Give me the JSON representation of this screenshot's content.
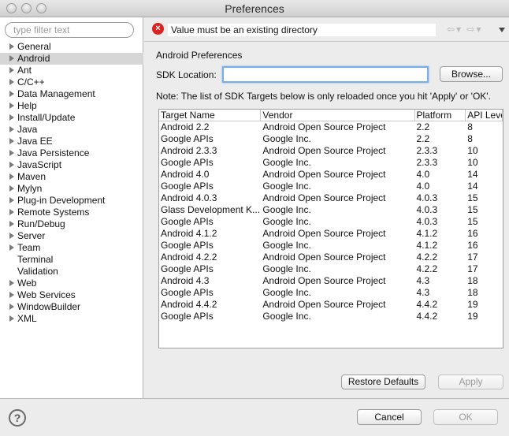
{
  "window": {
    "title": "Preferences"
  },
  "sidebar": {
    "filter_placeholder": "type filter text",
    "items": [
      {
        "label": "General",
        "expandable": true
      },
      {
        "label": "Android",
        "expandable": true,
        "selected": true
      },
      {
        "label": "Ant",
        "expandable": true
      },
      {
        "label": "C/C++",
        "expandable": true
      },
      {
        "label": "Data Management",
        "expandable": true
      },
      {
        "label": "Help",
        "expandable": true
      },
      {
        "label": "Install/Update",
        "expandable": true
      },
      {
        "label": "Java",
        "expandable": true
      },
      {
        "label": "Java EE",
        "expandable": true
      },
      {
        "label": "Java Persistence",
        "expandable": true
      },
      {
        "label": "JavaScript",
        "expandable": true
      },
      {
        "label": "Maven",
        "expandable": true
      },
      {
        "label": "Mylyn",
        "expandable": true
      },
      {
        "label": "Plug-in Development",
        "expandable": true
      },
      {
        "label": "Remote Systems",
        "expandable": true
      },
      {
        "label": "Run/Debug",
        "expandable": true
      },
      {
        "label": "Server",
        "expandable": true
      },
      {
        "label": "Team",
        "expandable": true
      },
      {
        "label": "Terminal",
        "expandable": false
      },
      {
        "label": "Validation",
        "expandable": false
      },
      {
        "label": "Web",
        "expandable": true
      },
      {
        "label": "Web Services",
        "expandable": true
      },
      {
        "label": "WindowBuilder",
        "expandable": true
      },
      {
        "label": "XML",
        "expandable": true
      }
    ]
  },
  "message": {
    "text": "Value must be an existing directory",
    "icon": "error-icon"
  },
  "page": {
    "title": "Android Preferences",
    "sdk_label": "SDK Location:",
    "sdk_value": "",
    "browse_label": "Browse...",
    "note": "Note: The list of SDK Targets below is only reloaded once you hit 'Apply' or 'OK'."
  },
  "table": {
    "headers": [
      "Target Name",
      "Vendor",
      "Platform",
      "API Level"
    ],
    "rows": [
      [
        "Android 2.2",
        "Android Open Source Project",
        "2.2",
        "8"
      ],
      [
        "Google APIs",
        "Google Inc.",
        "2.2",
        "8"
      ],
      [
        "Android 2.3.3",
        "Android Open Source Project",
        "2.3.3",
        "10"
      ],
      [
        "Google APIs",
        "Google Inc.",
        "2.3.3",
        "10"
      ],
      [
        "Android 4.0",
        "Android Open Source Project",
        "4.0",
        "14"
      ],
      [
        "Google APIs",
        "Google Inc.",
        "4.0",
        "14"
      ],
      [
        "Android 4.0.3",
        "Android Open Source Project",
        "4.0.3",
        "15"
      ],
      [
        "Glass Development K...",
        "Google Inc.",
        "4.0.3",
        "15"
      ],
      [
        "Google APIs",
        "Google Inc.",
        "4.0.3",
        "15"
      ],
      [
        "Android 4.1.2",
        "Android Open Source Project",
        "4.1.2",
        "16"
      ],
      [
        "Google APIs",
        "Google Inc.",
        "4.1.2",
        "16"
      ],
      [
        "Android 4.2.2",
        "Android Open Source Project",
        "4.2.2",
        "17"
      ],
      [
        "Google APIs",
        "Google Inc.",
        "4.2.2",
        "17"
      ],
      [
        "Android 4.3",
        "Android Open Source Project",
        "4.3",
        "18"
      ],
      [
        "Google APIs",
        "Google Inc.",
        "4.3",
        "18"
      ],
      [
        "Android 4.4.2",
        "Android Open Source Project",
        "4.4.2",
        "19"
      ],
      [
        "Google APIs",
        "Google Inc.",
        "4.4.2",
        "19"
      ]
    ]
  },
  "buttons": {
    "restore_defaults": "Restore Defaults",
    "apply": "Apply",
    "cancel": "Cancel",
    "ok": "OK",
    "help": "?"
  },
  "colors": {
    "error": "#dd2222",
    "focus": "#7aaee8",
    "selection": "#d6d6d6"
  }
}
